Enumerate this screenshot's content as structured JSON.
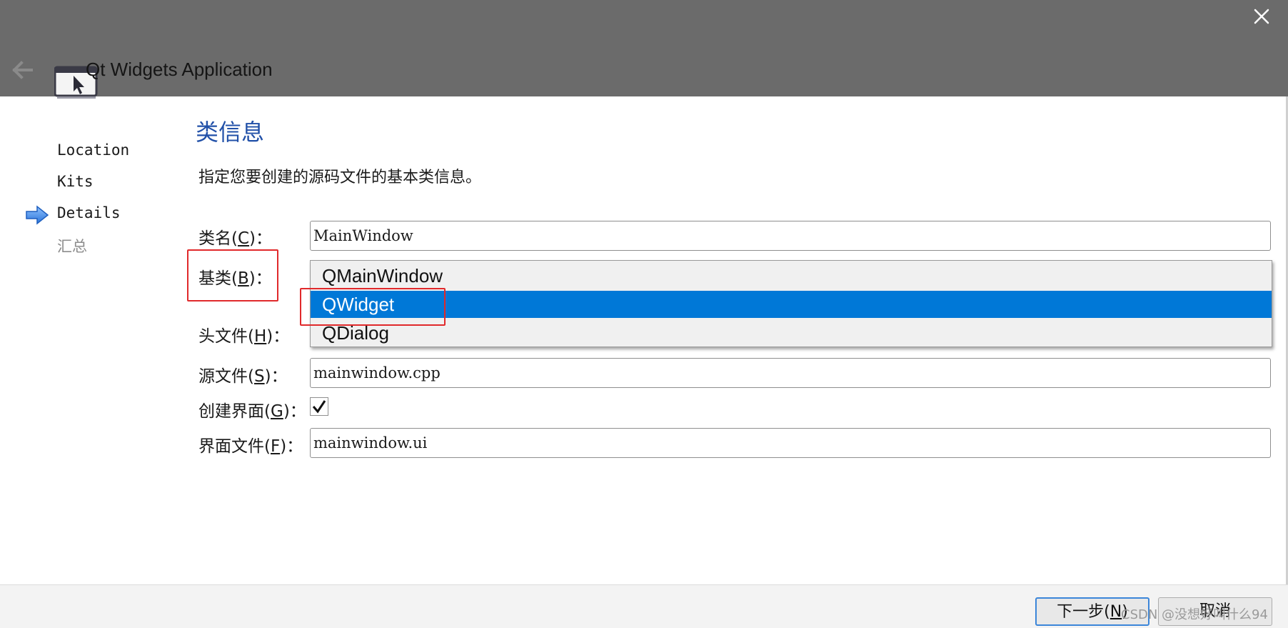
{
  "window": {
    "title": "Qt Widgets Application",
    "close_icon": "close-icon",
    "back_icon": "back-arrow-icon"
  },
  "sidebar": {
    "items": [
      {
        "label": "Location",
        "state": "done"
      },
      {
        "label": "Kits",
        "state": "done"
      },
      {
        "label": "Details",
        "state": "current"
      },
      {
        "label": "汇总",
        "state": "pending"
      }
    ]
  },
  "page": {
    "title": "类信息",
    "description": "指定您要创建的源码文件的基本类信息。"
  },
  "form": {
    "class_name_label_pre": "类名(",
    "class_name_label_key": "C",
    "class_name_label_post": ")：",
    "class_name_value": "MainWindow",
    "base_class_label_pre": "基类(",
    "base_class_label_key": "B",
    "base_class_label_post": ")：",
    "header_file_label_pre": "头文件(",
    "header_file_label_key": "H",
    "header_file_label_post": ")：",
    "source_file_label_pre": "源文件(",
    "source_file_label_key": "S",
    "source_file_label_post": ")：",
    "source_file_value": "mainwindow.cpp",
    "generate_form_label_pre": "创建界面(",
    "generate_form_label_key": "G",
    "generate_form_label_post": ")：",
    "generate_form_checked": true,
    "form_file_label_pre": "界面文件(",
    "form_file_label_key": "F",
    "form_file_label_post": ")：",
    "form_file_value": "mainwindow.ui"
  },
  "base_class_dropdown": {
    "options": [
      "QMainWindow",
      "QWidget",
      "QDialog"
    ],
    "highlighted": "QWidget"
  },
  "footer": {
    "next_label_pre": "下一步(",
    "next_label_key": "N",
    "next_label_post": ")",
    "cancel_label": "取消"
  },
  "watermark": "CSDN @没想好叫什么94",
  "colors": {
    "titlebar": "#6b6b6b",
    "accent_title": "#2150a8",
    "selection": "#0078d7",
    "annotation": "#e0292b"
  }
}
